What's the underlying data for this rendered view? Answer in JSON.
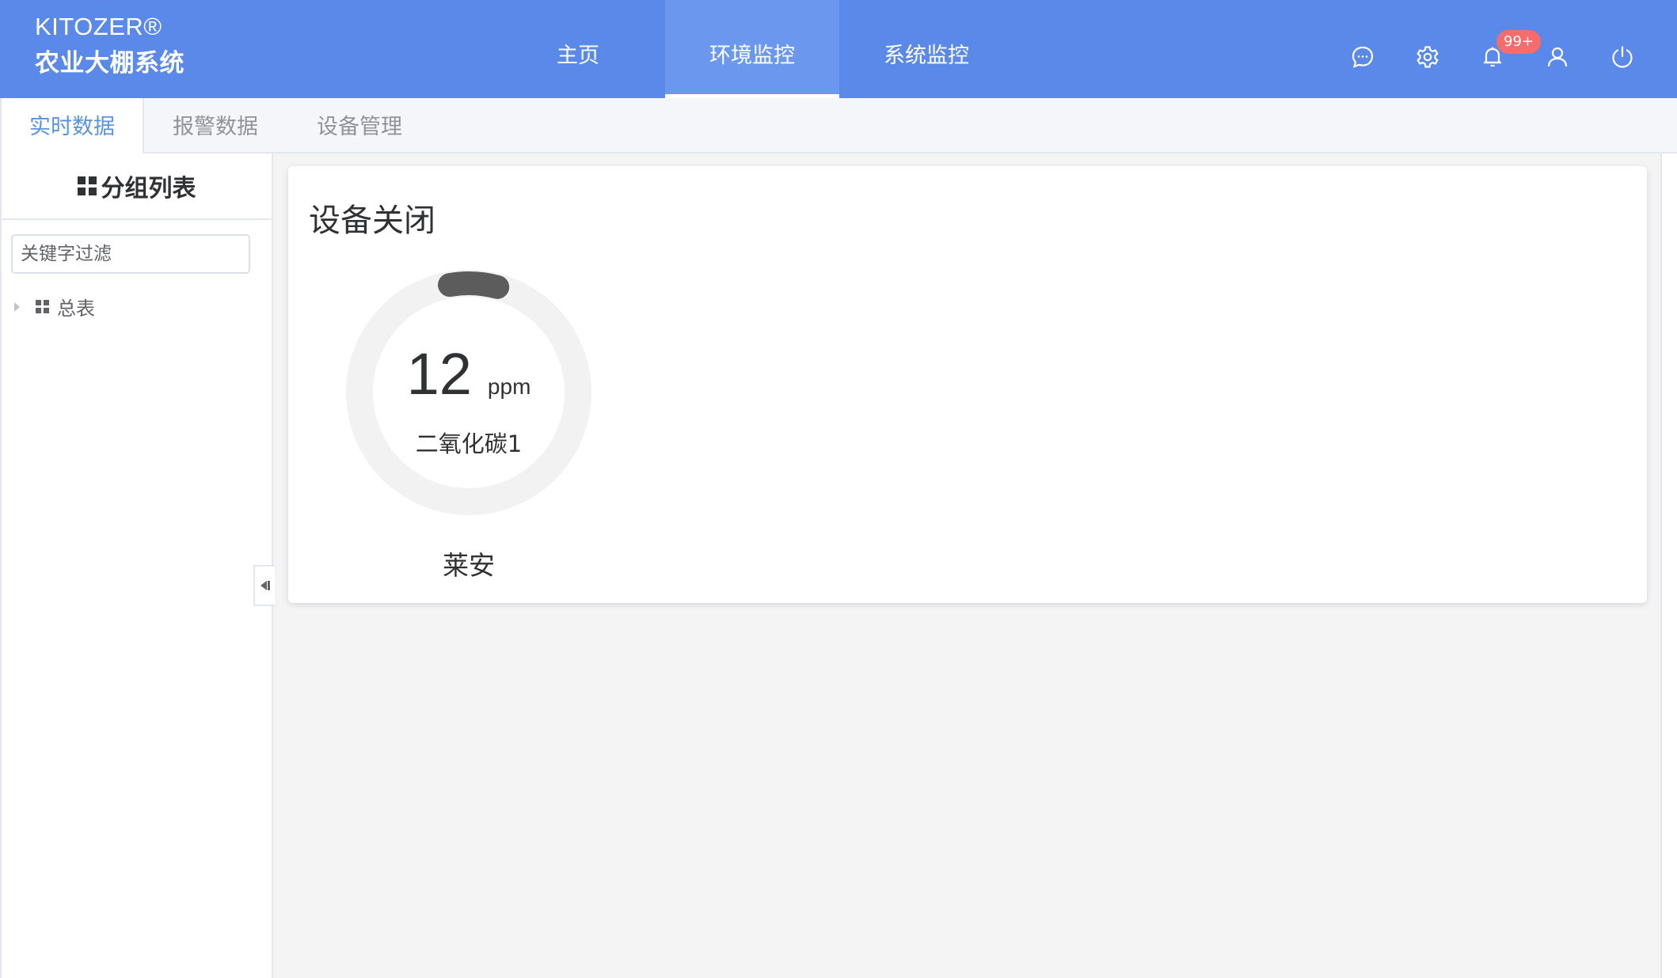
{
  "header": {
    "brand_en": "KITOZER®",
    "brand_cn": "农业大棚系统",
    "nav": [
      {
        "label": "主页"
      },
      {
        "label": "环境监控"
      },
      {
        "label": "系统监控"
      }
    ],
    "active_nav": "环境监控",
    "notification_badge": "99+",
    "icons": [
      "chat-icon",
      "settings-gear-icon",
      "bell-icon",
      "user-icon",
      "power-icon"
    ],
    "colors": {
      "background": "#5a89ea",
      "active_tab": "#6b97ef"
    }
  },
  "tabs": [
    {
      "label": "实时数据"
    },
    {
      "label": "报警数据"
    },
    {
      "label": "设备管理"
    }
  ],
  "active_tab": "实时数据",
  "sidebar": {
    "title": "分组列表",
    "filter_placeholder": "关键字过滤",
    "tree": [
      {
        "label": "总表"
      }
    ]
  },
  "card": {
    "status": "设备关闭",
    "gauge": {
      "value": "12",
      "unit": "ppm",
      "label": "二氧化碳1",
      "fill_fraction": 0.07,
      "track_color": "#f2f2f2",
      "fill_color": "#5c5c5c"
    },
    "device_name": "莱安"
  },
  "colors": {
    "accent": "#5a93dc",
    "badge": "#f56c6c"
  }
}
